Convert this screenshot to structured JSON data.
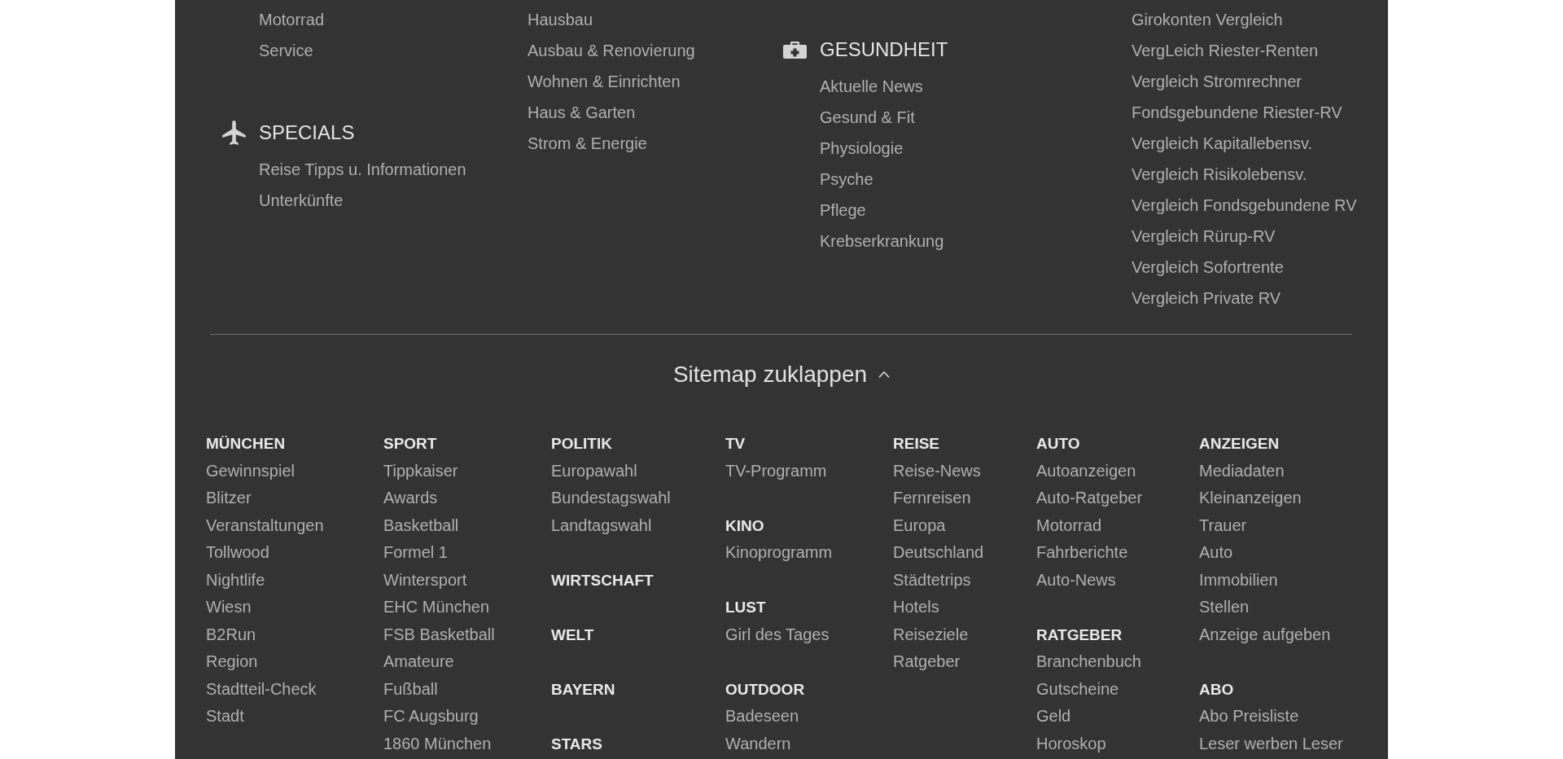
{
  "top_sitemap": {
    "columns": [
      {
        "groups": [
          {
            "items": [
              "Motorrad",
              "Service"
            ]
          },
          {
            "heading": "SPECIALS",
            "items": [
              "Reise Tipps u. Informationen",
              "Unterkünfte"
            ]
          }
        ]
      },
      {
        "groups": [
          {
            "items": [
              "Hausbau",
              "Ausbau & Renovierung",
              "Wohnen & Einrichten",
              "Haus & Garten",
              "Strom & Energie"
            ]
          }
        ]
      },
      {
        "groups": [
          {
            "heading": "GESUNDHEIT",
            "items": [
              "Aktuelle News",
              "Gesund & Fit",
              "Physiologie",
              "Psyche",
              "Pflege",
              "Krebserkrankung"
            ]
          }
        ]
      },
      {
        "groups": [
          {
            "items": [
              "Girokonten Vergleich",
              "VergLeich Riester-Renten",
              "Vergleich Stromrechner",
              "Fondsgebundene Riester-RV",
              "Vergleich Kapitallebensv.",
              "Vergleich Risikolebensv.",
              "Vergleich Fondsgebundene RV",
              "Vergleich Rürup-RV",
              "Vergleich Sofortrente",
              "Vergleich Private RV"
            ]
          }
        ]
      }
    ]
  },
  "sitemap": {
    "toggle": {
      "label": "Sitemap zuklappen",
      "expanded": true
    },
    "columns": [
      {
        "groups": [
          {
            "heading": "MÜNCHEN",
            "items": [
              "Gewinnspiel",
              "Blitzer",
              "Veranstaltungen",
              "Tollwood",
              "Nightlife",
              "Wiesn",
              "B2Run",
              "Region",
              "Stadtteil-Check",
              "Stadt"
            ]
          }
        ]
      },
      {
        "groups": [
          {
            "heading": "SPORT",
            "items": [
              "Tippkaiser",
              "Awards",
              "Basketball",
              "Formel 1",
              "Wintersport",
              "EHC München",
              "FSB Basketball",
              "Amateure",
              "Fußball",
              "FC Augsburg",
              "1860 München"
            ]
          }
        ]
      },
      {
        "groups": [
          {
            "heading": "POLITIK",
            "items": [
              "Europawahl",
              "Bundestagswahl",
              "Landtagswahl"
            ]
          },
          {
            "heading": "WIRTSCHAFT"
          },
          {
            "heading": "WELT"
          },
          {
            "heading": "BAYERN"
          },
          {
            "heading": "STARS"
          }
        ]
      },
      {
        "groups": [
          {
            "heading": "TV",
            "items": [
              "TV-Programm"
            ]
          },
          {
            "heading": "KINO",
            "items": [
              "Kinoprogramm"
            ]
          },
          {
            "heading": "LUST",
            "items": [
              "Girl des Tages"
            ]
          },
          {
            "heading": "OUTDOOR",
            "items": [
              "Badeseen",
              "Wandern"
            ]
          }
        ]
      },
      {
        "groups": [
          {
            "heading": "REISE",
            "items": [
              "Reise-News",
              "Fernreisen",
              "Europa",
              "Deutschland",
              "Städtetrips",
              "Hotels",
              "Reiseziele",
              "Ratgeber"
            ]
          }
        ]
      },
      {
        "groups": [
          {
            "heading": "AUTO",
            "items": [
              "Autoanzeigen",
              "Auto-Ratgeber",
              "Motorrad",
              "Fahrberichte",
              "Auto-News"
            ]
          },
          {
            "heading": "RATGEBER",
            "items": [
              "Branchenbuch",
              "Gutscheine",
              "Geld",
              "Horoskop"
            ]
          }
        ]
      },
      {
        "groups": [
          {
            "heading": "ANZEIGEN",
            "items": [
              "Mediadaten",
              "Kleinanzeigen",
              "Trauer",
              "Auto",
              "Immobilien",
              "Stellen",
              "Anzeige aufgeben"
            ]
          },
          {
            "heading": "ABO",
            "items": [
              "Abo Preisliste",
              "Leser werben Leser"
            ]
          }
        ]
      }
    ]
  }
}
